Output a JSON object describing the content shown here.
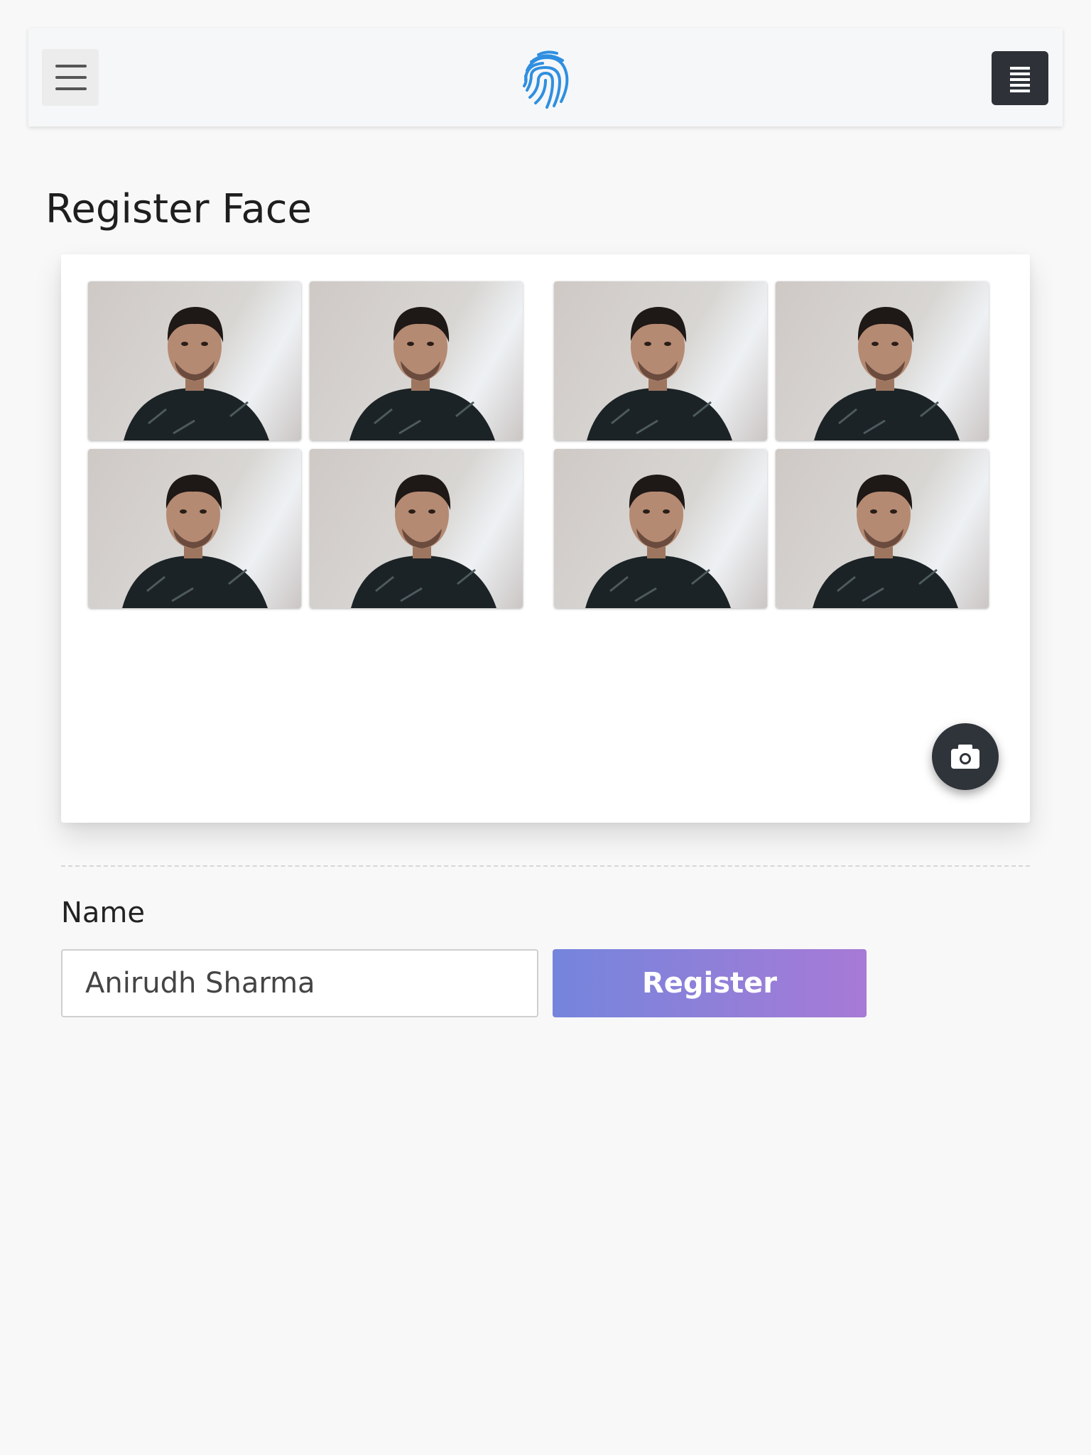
{
  "navbar": {
    "hamburger_icon": "hamburger-icon",
    "logo_icon": "fingerprint-icon",
    "menu_icon": "list-icon",
    "logo_color": "#2f8fe0"
  },
  "page": {
    "title": "Register Face"
  },
  "captures": {
    "count": 8,
    "images": [
      {
        "subject": "captured-face-photo"
      },
      {
        "subject": "captured-face-photo"
      },
      {
        "subject": "captured-face-photo"
      },
      {
        "subject": "captured-face-photo"
      },
      {
        "subject": "captured-face-photo"
      },
      {
        "subject": "captured-face-photo"
      },
      {
        "subject": "captured-face-photo"
      },
      {
        "subject": "captured-face-photo"
      }
    ],
    "capture_icon": "camera-icon"
  },
  "form": {
    "name_label": "Name",
    "name_value": "Anirudh Sharma",
    "register_label": "Register"
  },
  "colors": {
    "button_gradient_start": "#7585dc",
    "button_gradient_end": "#a77ad6",
    "dark_button": "#2e3238"
  }
}
